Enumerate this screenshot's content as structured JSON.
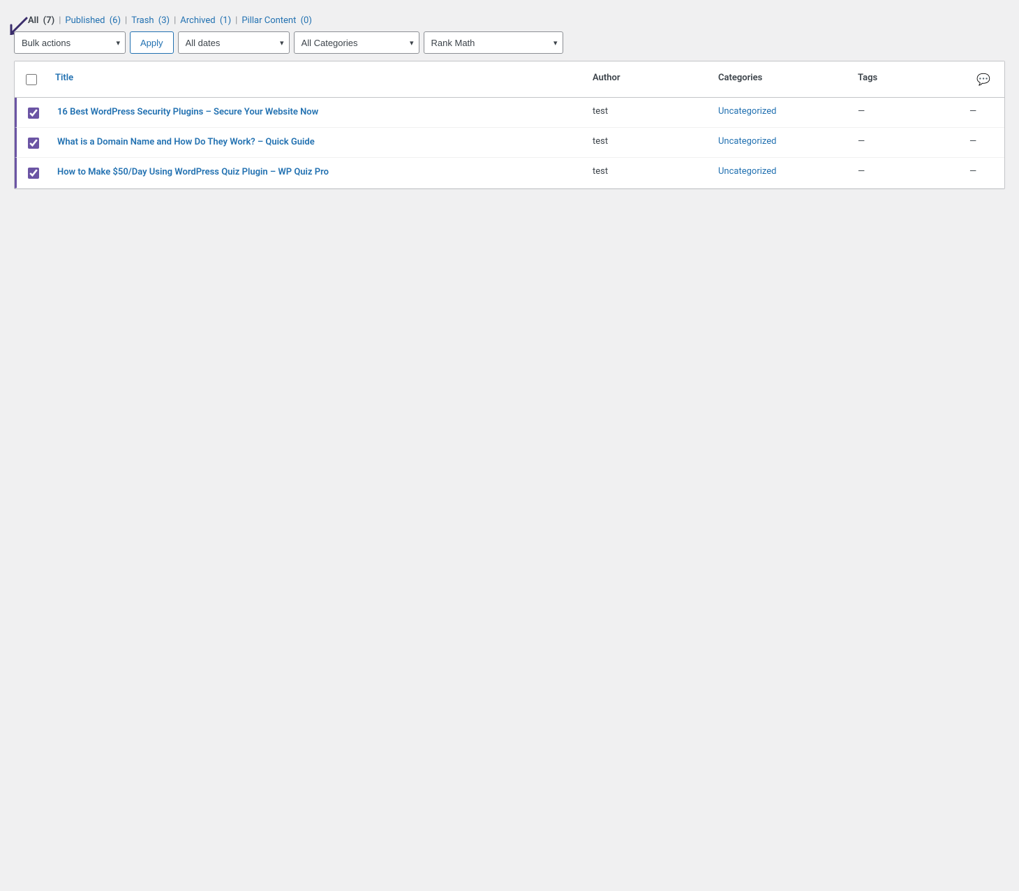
{
  "filters": {
    "all_label": "All",
    "all_count": "(7)",
    "published_label": "Published",
    "published_count": "(6)",
    "trash_label": "Trash",
    "trash_count": "(3)",
    "archived_label": "Archived",
    "archived_count": "(1)",
    "pillar_label": "Pillar Content",
    "pillar_count": "(0)"
  },
  "toolbar": {
    "bulk_actions_label": "Bulk actions",
    "apply_label": "Apply",
    "all_dates_label": "All dates",
    "all_categories_label": "All Categories",
    "rank_math_label": "Rank Math"
  },
  "table": {
    "columns": {
      "title": "Title",
      "author": "Author",
      "categories": "Categories",
      "tags": "Tags",
      "comments": "💬"
    },
    "rows": [
      {
        "selected": true,
        "title": "16 Best WordPress Security Plugins – Secure Your Website Now",
        "author": "test",
        "categories": "Uncategorized",
        "tags": "—",
        "comments": "—"
      },
      {
        "selected": true,
        "title": "What is a Domain Name and How Do They Work? – Quick Guide",
        "author": "test",
        "categories": "Uncategorized",
        "tags": "—",
        "comments": "—"
      },
      {
        "selected": true,
        "title": "How to Make $50/Day Using WordPress Quiz Plugin – WP Quiz Pro",
        "author": "test",
        "categories": "Uncategorized",
        "tags": "—",
        "comments": "—"
      }
    ]
  }
}
